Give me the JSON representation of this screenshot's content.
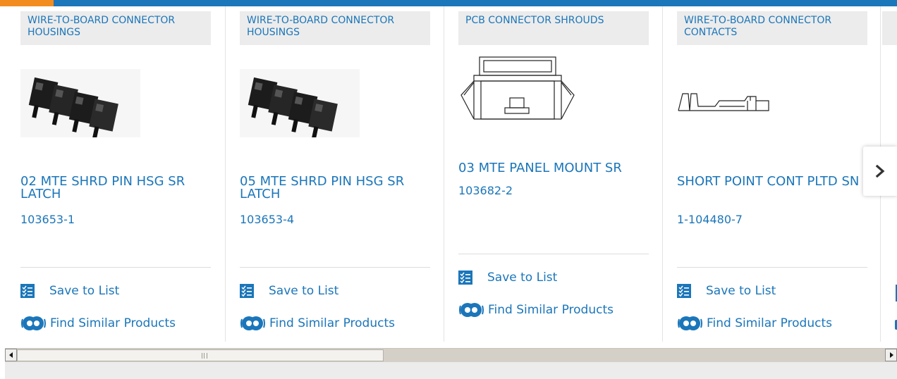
{
  "carousel": {
    "cards": [
      {
        "category": "WIRE-TO-BOARD CONNECTOR HOUSINGS",
        "name": "02 MTE SHRD PIN HSG SR LATCH",
        "part_number": "103653-1",
        "image_icon": "connector-housing-photo"
      },
      {
        "category": "WIRE-TO-BOARD CONNECTOR HOUSINGS",
        "name": "05 MTE SHRD PIN HSG SR LATCH",
        "part_number": "103653-4",
        "image_icon": "connector-housing-photo"
      },
      {
        "category": "PCB CONNECTOR SHROUDS",
        "name": "03 MTE PANEL MOUNT SR",
        "part_number": "103682-2",
        "image_icon": "connector-shroud-drawing"
      },
      {
        "category": "WIRE-TO-BOARD CONNECTOR CONTACTS",
        "name": "SHORT POINT CONT PLTD SN",
        "part_number": "1-104480-7",
        "image_icon": "contact-drawing"
      }
    ],
    "actions": {
      "save_label": "Save to List",
      "similar_label": "Find Similar Products"
    },
    "next_icon": "chevron-right-icon"
  },
  "colors": {
    "link": "#1b76ba",
    "top_bar": "#1b76ba",
    "top_bar_accent": "#f28c1f",
    "category_bg": "#ececec"
  },
  "scrollbar": {
    "left_icon": "arrow-left-icon",
    "right_icon": "arrow-right-icon"
  }
}
